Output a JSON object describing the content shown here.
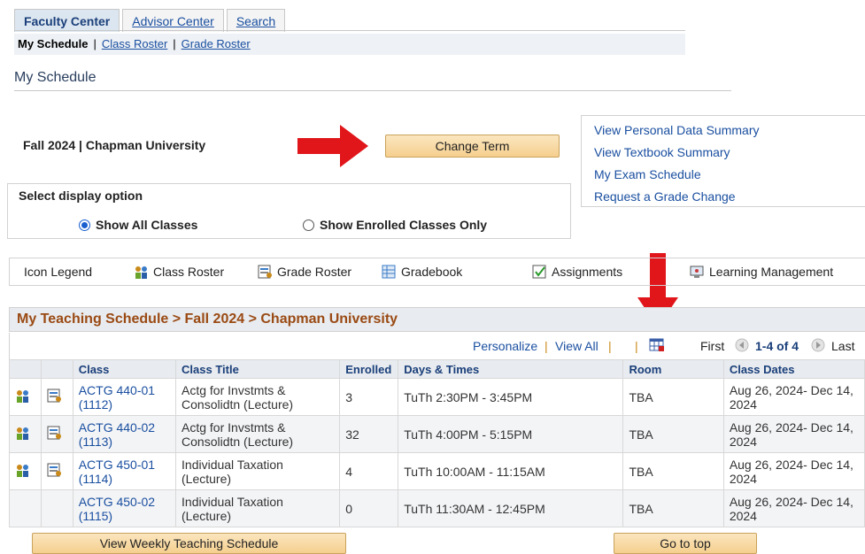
{
  "tabs": [
    {
      "label": "Faculty Center",
      "active": true
    },
    {
      "label": "Advisor Center",
      "active": false
    },
    {
      "label": "Search",
      "active": false
    }
  ],
  "subnav": {
    "current": "My Schedule",
    "sep1": "|",
    "link1": "Class Roster",
    "sep2": "|",
    "link2": "Grade Roster"
  },
  "page_title": "My Schedule",
  "term": {
    "label": "Fall 2024 | Chapman University",
    "change_button": "Change Term"
  },
  "links": [
    "View Personal Data Summary",
    "View Textbook Summary",
    "My Exam Schedule",
    "Request a Grade Change"
  ],
  "display_option": {
    "title": "Select display option",
    "options": [
      {
        "label": "Show All Classes",
        "selected": true
      },
      {
        "label": "Show Enrolled Classes Only",
        "selected": false
      }
    ]
  },
  "legend": {
    "label": "Icon Legend",
    "items": [
      {
        "label": "Class Roster",
        "icon": "class-roster-icon"
      },
      {
        "label": "Grade Roster",
        "icon": "grade-roster-icon"
      },
      {
        "label": "Gradebook",
        "icon": "gradebook-icon"
      },
      {
        "label": "Assignments",
        "icon": "assignments-icon"
      },
      {
        "label": "Learning Management",
        "icon": "learning-management-icon"
      }
    ]
  },
  "schedule": {
    "title": "My Teaching Schedule > Fall 2024 > Chapman University",
    "personalize": "Personalize",
    "view_all": "View All",
    "sep": "|",
    "first": "First",
    "range": "1-4 of 4",
    "last": "Last",
    "columns": [
      "Class",
      "Class Title",
      "Enrolled",
      "Days & Times",
      "Room",
      "Class Dates"
    ],
    "rows": [
      {
        "class": "ACTG 440-01 (1112)",
        "title": "Actg for Invstmts & Consolidtn (Lecture)",
        "enrolled": "3",
        "days_times": "TuTh 2:30PM - 3:45PM",
        "room": "TBA",
        "dates": "Aug 26, 2024- Dec 14, 2024",
        "icons": true
      },
      {
        "class": "ACTG 440-02 (1113)",
        "title": "Actg for Invstmts & Consolidtn (Lecture)",
        "enrolled": "32",
        "days_times": "TuTh 4:00PM - 5:15PM",
        "room": "TBA",
        "dates": "Aug 26, 2024- Dec 14, 2024",
        "icons": true
      },
      {
        "class": "ACTG 450-01 (1114)",
        "title": "Individual Taxation (Lecture)",
        "enrolled": "4",
        "days_times": "TuTh 10:00AM - 11:15AM",
        "room": "TBA",
        "dates": "Aug 26, 2024- Dec 14, 2024",
        "icons": true
      },
      {
        "class": "ACTG 450-02 (1115)",
        "title": "Individual Taxation (Lecture)",
        "enrolled": "0",
        "days_times": "TuTh 11:30AM - 12:45PM",
        "room": "TBA",
        "dates": "Aug 26, 2024- Dec 14, 2024",
        "icons": false
      }
    ]
  },
  "buttons": {
    "weekly": "View Weekly Teaching Schedule",
    "top": "Go to top"
  },
  "colors": {
    "arrow": "#e0161b",
    "header_text": "#9a4a14",
    "link": "#1a4fa0",
    "button": "#f5cf8e"
  }
}
